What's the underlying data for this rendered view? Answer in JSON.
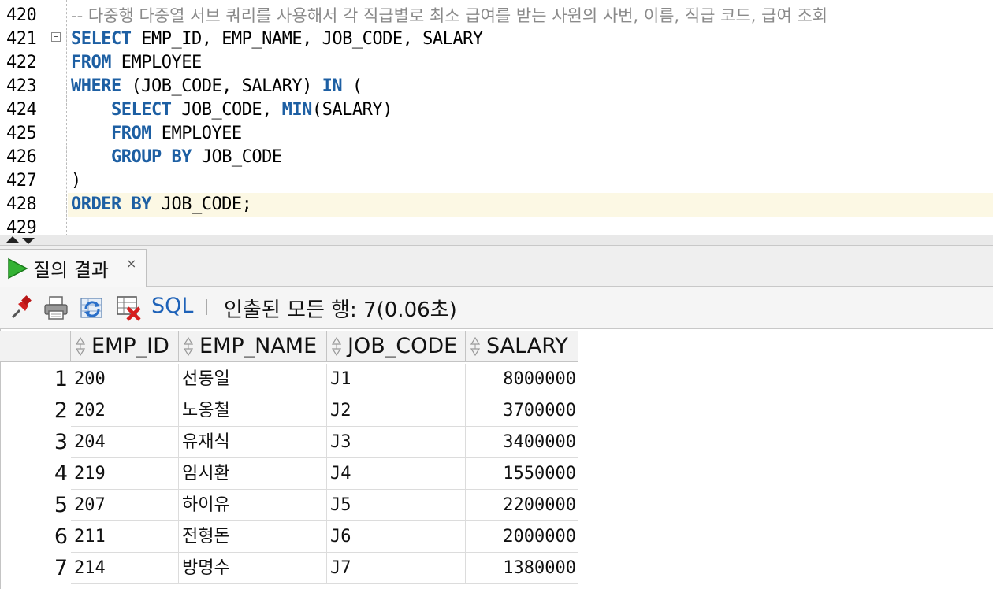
{
  "editor": {
    "lines": [
      {
        "no": "420",
        "segments": [
          {
            "t": "-- 다중행 다중열 서브 쿼리를 사용해서 각 직급별로 최소 급여를 받는 사원의 사번, 이름, 직급 코드, 급여 조회",
            "c": "cm"
          }
        ]
      },
      {
        "no": "421",
        "segments": [
          {
            "t": "SELECT",
            "c": "kw"
          },
          {
            "t": " EMP_ID, EMP_NAME, JOB_CODE, SALARY",
            "c": ""
          }
        ]
      },
      {
        "no": "422",
        "segments": [
          {
            "t": "FROM",
            "c": "kw"
          },
          {
            "t": " EMPLOYEE",
            "c": ""
          }
        ]
      },
      {
        "no": "423",
        "segments": [
          {
            "t": "WHERE",
            "c": "kw"
          },
          {
            "t": " (JOB_CODE, SALARY) ",
            "c": ""
          },
          {
            "t": "IN",
            "c": "kw"
          },
          {
            "t": " (",
            "c": ""
          }
        ]
      },
      {
        "no": "424",
        "segments": [
          {
            "t": "    ",
            "c": ""
          },
          {
            "t": "SELECT",
            "c": "kw"
          },
          {
            "t": " JOB_CODE, ",
            "c": ""
          },
          {
            "t": "MIN",
            "c": "kw"
          },
          {
            "t": "(SALARY)",
            "c": ""
          }
        ]
      },
      {
        "no": "425",
        "segments": [
          {
            "t": "    ",
            "c": ""
          },
          {
            "t": "FROM",
            "c": "kw"
          },
          {
            "t": " EMPLOYEE",
            "c": ""
          }
        ]
      },
      {
        "no": "426",
        "segments": [
          {
            "t": "    ",
            "c": ""
          },
          {
            "t": "GROUP BY",
            "c": "kw"
          },
          {
            "t": " JOB_CODE",
            "c": ""
          }
        ]
      },
      {
        "no": "427",
        "segments": [
          {
            "t": ")",
            "c": ""
          }
        ]
      },
      {
        "no": "428",
        "segments": [
          {
            "t": "ORDER BY",
            "c": "kw"
          },
          {
            "t": " JOB_CODE;",
            "c": ""
          }
        ]
      },
      {
        "no": "429",
        "segments": []
      }
    ],
    "current_line_color": "#fcf8e4",
    "keyword_color": "#1d5fa3",
    "comment_color": "#8a8a8a"
  },
  "results": {
    "tab_label": "질의 결과",
    "tab_close": "×",
    "toolbar": {
      "icons": [
        "pin-icon",
        "print-icon",
        "refresh-icon",
        "delete-icon"
      ],
      "sql_label": "SQL",
      "separator": "|",
      "status": "인출된 모든 행: 7(0.06초)"
    },
    "columns": [
      "EMP_ID",
      "EMP_NAME",
      "JOB_CODE",
      "SALARY"
    ],
    "rows": [
      {
        "n": "1",
        "emp_id": "200",
        "emp_name": "선동일",
        "job_code": "J1",
        "salary": "8000000"
      },
      {
        "n": "2",
        "emp_id": "202",
        "emp_name": "노옹철",
        "job_code": "J2",
        "salary": "3700000"
      },
      {
        "n": "3",
        "emp_id": "204",
        "emp_name": "유재식",
        "job_code": "J3",
        "salary": "3400000"
      },
      {
        "n": "4",
        "emp_id": "219",
        "emp_name": "임시환",
        "job_code": "J4",
        "salary": "1550000"
      },
      {
        "n": "5",
        "emp_id": "207",
        "emp_name": "하이유",
        "job_code": "J5",
        "salary": "2200000"
      },
      {
        "n": "6",
        "emp_id": "211",
        "emp_name": "전형돈",
        "job_code": "J6",
        "salary": "2000000"
      },
      {
        "n": "7",
        "emp_id": "214",
        "emp_name": "방명수",
        "job_code": "J7",
        "salary": "1380000"
      }
    ],
    "sql_color": "#1e62b8"
  }
}
